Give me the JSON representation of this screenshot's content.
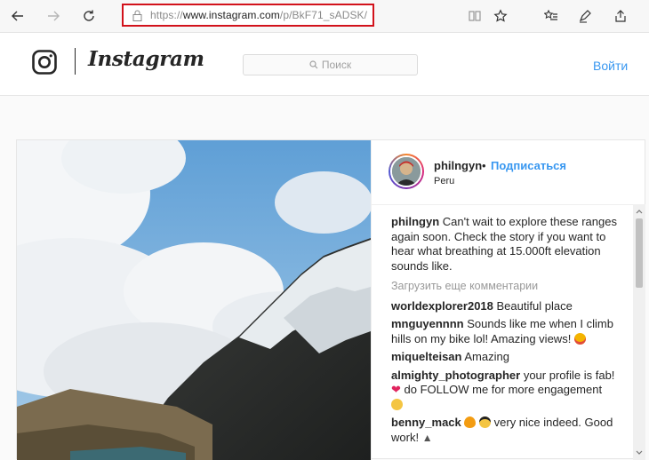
{
  "browser": {
    "url_scheme": "https://",
    "url_host": "www.instagram.com",
    "url_path": "/p/BkF71_sADSK/"
  },
  "header": {
    "wordmark": "Instagram",
    "search_placeholder": "Поиск",
    "login_label": "Войти"
  },
  "post": {
    "username": "philngyn",
    "separator": "•",
    "follow_label": "Подписаться",
    "location": "Peru",
    "caption_user": "philngyn",
    "caption_text": "Can't wait to explore these ranges again soon. Check the story if you want to hear what breathing at 15.000ft elevation sounds like.",
    "load_more_label": "Загрузить еще комментарии",
    "comments": [
      {
        "user": "worldexplorer2018",
        "text": "Beautiful place",
        "emoji_after": ""
      },
      {
        "user": "mnguyennnn",
        "text": "Sounds like me when I climb hills on my bike lol! Amazing views!",
        "emoji_after": "star-eyes-emoji"
      },
      {
        "user": "miquelteisan",
        "text": "Amazing",
        "emoji_after": ""
      },
      {
        "user": "almighty_photographer",
        "text": "your profile is fab!",
        "emoji_after": ""
      },
      {
        "user": "benny_mack",
        "text": "very nice indeed. Good work!",
        "emoji_after": ""
      }
    ],
    "comment3_line2": "do FOLLOW me for more engagement"
  },
  "colors": {
    "accent": "#3897f0",
    "highlight_border": "#d2121b",
    "text": "#262626"
  }
}
